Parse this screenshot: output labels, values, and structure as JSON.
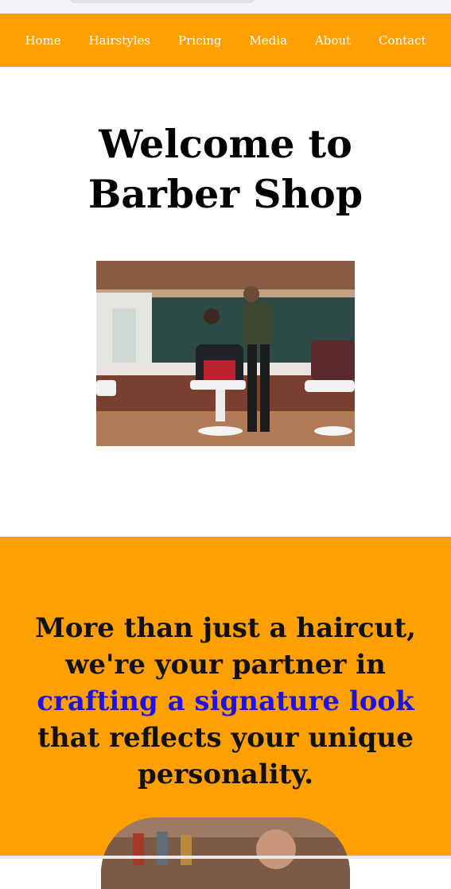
{
  "nav": {
    "items": [
      "Home",
      "Hairstyles",
      "Pricing",
      "Media",
      "About",
      "Contact"
    ]
  },
  "hero": {
    "title_line1": "Welcome to",
    "title_line2": "Barber Shop"
  },
  "tagline": {
    "part1": "More than just a haircut, we're your partner in",
    "highlight": "crafting a signature look",
    "part2": "that reflects your unique personality."
  },
  "colors": {
    "accent": "#ffa000",
    "highlight": "#1e10e6"
  }
}
